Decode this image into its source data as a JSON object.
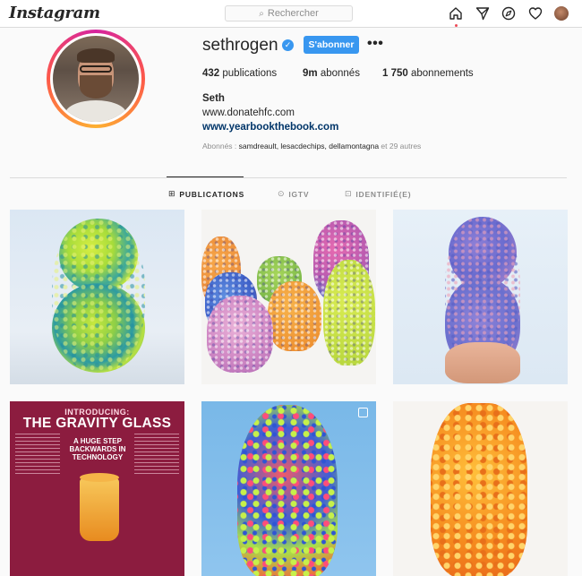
{
  "app": {
    "logo": "Instagram"
  },
  "search": {
    "placeholder": "Rechercher"
  },
  "nav": {
    "icons": [
      "home-icon",
      "direct-icon",
      "explore-icon",
      "activity-heart-icon",
      "profile-avatar"
    ]
  },
  "profile": {
    "username": "sethrogen",
    "verified": true,
    "follow_label": "S'abonner",
    "more_label": "•••",
    "posts_count": "432",
    "posts_label": "publications",
    "followers_count": "9m",
    "followers_label": "abonnés",
    "following_count": "1 750",
    "following_label": "abonnements",
    "full_name": "Seth",
    "bio_line": "www.donatehfc.com",
    "link": "www.yearbookthebook.com",
    "followed_by_prefix": "Abonnés : ",
    "followed_by_names": "samdreault, lesacdechips, dellamontagna",
    "followed_by_suffix": " et 29 autres"
  },
  "tabs": [
    {
      "label": "PUBLICATIONS",
      "icon": "grid-icon",
      "glyph": "⊞",
      "active": true
    },
    {
      "label": "IGTV",
      "icon": "igtv-icon",
      "glyph": "⊙",
      "active": false
    },
    {
      "label": "IDENTIFIÉ(E)",
      "icon": "tagged-icon",
      "glyph": "⊡",
      "active": false
    }
  ],
  "posts": [
    {
      "kind": "green-blue-marbled-vase"
    },
    {
      "kind": "group-of-colorful-vases"
    },
    {
      "kind": "blue-pink-marbled-vase"
    },
    {
      "kind": "gravity-glass-ad",
      "headline_small": "INTRODUCING:",
      "headline_big": "THE GRAVITY GLASS",
      "tagline": "A HUGE STEP BACKWARDS IN TECHNOLOGY"
    },
    {
      "kind": "rainbow-bumpy-vase",
      "multi": true
    },
    {
      "kind": "orange-bumpy-vase"
    }
  ],
  "colors": {
    "accent_blue": "#3897f0",
    "link_blue": "#003569",
    "text": "#262626",
    "muted": "#8e8e8e",
    "border": "#dbdbdb"
  }
}
